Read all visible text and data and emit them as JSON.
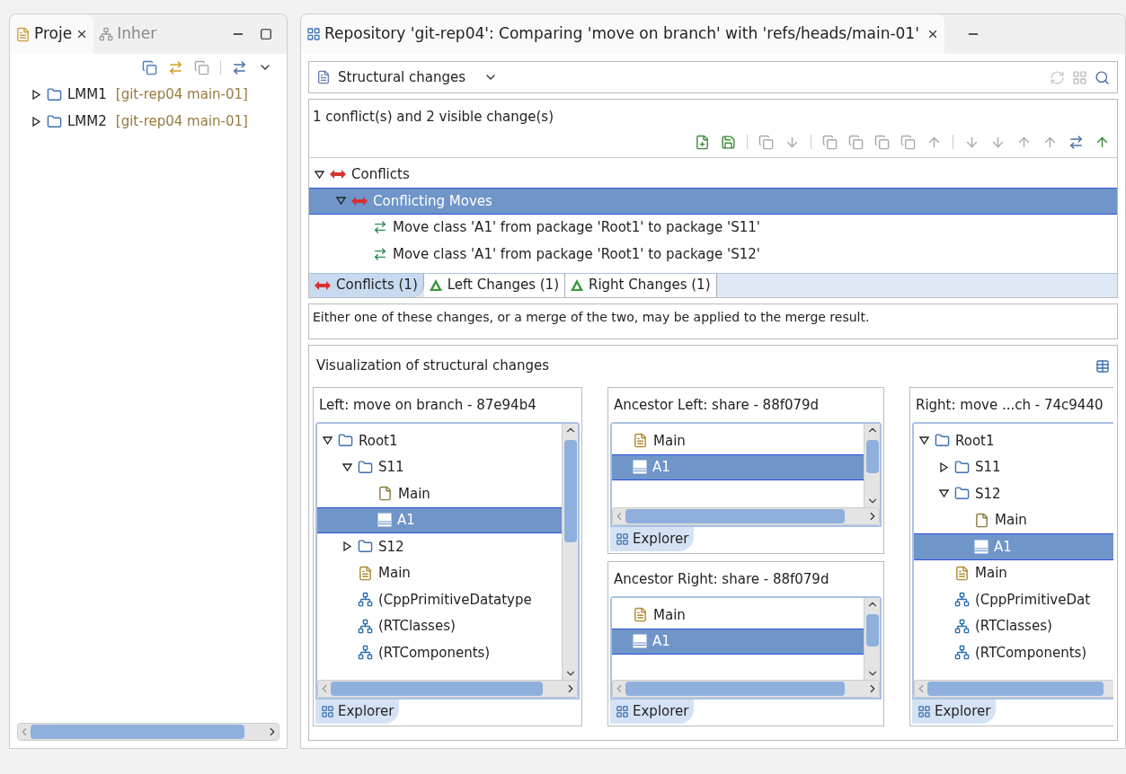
{
  "project_view": {
    "tabs": [
      {
        "label": "Proje",
        "selected": true,
        "closable": true
      },
      {
        "label": "Inher",
        "selected": false,
        "closable": false
      }
    ],
    "tree": [
      {
        "label": "LMM1",
        "decoration": "[git-rep04 main-01]",
        "expanded": false
      },
      {
        "label": "LMM2",
        "decoration": "[git-rep04 main-01]",
        "expanded": false
      }
    ]
  },
  "editor": {
    "title": "Repository 'git-rep04': Comparing 'move on branch' with 'refs/heads/main-01'",
    "viewer": "Structural changes",
    "summary": "1 conflict(s) and 2 visible change(s)",
    "tree": [
      {
        "label": "Conflicts",
        "kind": "conflict",
        "expanded": true,
        "selected": false,
        "children": [
          {
            "label": "Conflicting Moves",
            "kind": "conflict",
            "expanded": true,
            "selected": true,
            "children": [
              {
                "label": "Move class 'A1' from package 'Root1' to package 'S11'",
                "kind": "move",
                "selected": false
              },
              {
                "label": "Move class 'A1' from package 'Root1' to package 'S12'",
                "kind": "move",
                "selected": false
              }
            ]
          }
        ]
      }
    ],
    "tabs": [
      {
        "label": "Conflicts (1)",
        "kind": "conflict",
        "selected": true
      },
      {
        "label": "Left Changes (1)",
        "kind": "change",
        "selected": false
      },
      {
        "label": "Right Changes (1)",
        "kind": "change",
        "selected": false
      }
    ],
    "description": "Either one of these changes, or a merge of the two, may be applied to the merge result.",
    "visualization": {
      "title": "Visualization of structural changes",
      "panes": [
        {
          "title": "Left: move on branch - 87e94b4",
          "tab": "Explorer",
          "rows": [
            {
              "label": "Root1",
              "kind": "folder",
              "expanded": true,
              "selected": false,
              "children": [
                {
                  "label": "S11",
                  "kind": "package",
                  "expanded": true,
                  "selected": false,
                  "children": [
                    {
                      "label": "Main",
                      "kind": "file",
                      "selected": false
                    },
                    {
                      "label": "A1",
                      "kind": "class",
                      "selected": true
                    }
                  ]
                },
                {
                  "label": "S12",
                  "kind": "package",
                  "expanded": false,
                  "selected": false
                },
                {
                  "label": "Main",
                  "kind": "model",
                  "selected": false
                },
                {
                  "label": "(CppPrimitiveDatatype",
                  "kind": "ref",
                  "selected": false
                },
                {
                  "label": "(RTClasses)",
                  "kind": "ref",
                  "selected": false
                },
                {
                  "label": "(RTComponents)",
                  "kind": "ref",
                  "selected": false
                }
              ]
            }
          ]
        },
        {
          "title": "Ancestor Left: share - 88f079d",
          "tab": "Explorer",
          "rows": [
            {
              "label": "Main",
              "kind": "model",
              "selected": false
            },
            {
              "label": "A1",
              "kind": "class",
              "selected": true
            }
          ]
        },
        {
          "title": "Ancestor Right: share - 88f079d",
          "tab": "Explorer",
          "rows": [
            {
              "label": "Main",
              "kind": "model",
              "selected": false
            },
            {
              "label": "A1",
              "kind": "class",
              "selected": true
            }
          ]
        },
        {
          "title": "Right: move ...ch - 74c9440",
          "tab": "Explorer",
          "rows": [
            {
              "label": "Root1",
              "kind": "folder",
              "expanded": true,
              "selected": false,
              "children": [
                {
                  "label": "S11",
                  "kind": "package",
                  "expanded": false,
                  "selected": false
                },
                {
                  "label": "S12",
                  "kind": "package",
                  "expanded": true,
                  "selected": false,
                  "children": [
                    {
                      "label": "Main",
                      "kind": "file",
                      "selected": false
                    },
                    {
                      "label": "A1",
                      "kind": "class",
                      "selected": true
                    }
                  ]
                },
                {
                  "label": "Main",
                  "kind": "model",
                  "selected": false
                },
                {
                  "label": "(CppPrimitiveDat",
                  "kind": "ref",
                  "selected": false
                },
                {
                  "label": "(RTClasses)",
                  "kind": "ref",
                  "selected": false
                },
                {
                  "label": "(RTComponents)",
                  "kind": "ref",
                  "selected": false
                }
              ]
            }
          ]
        }
      ]
    }
  }
}
